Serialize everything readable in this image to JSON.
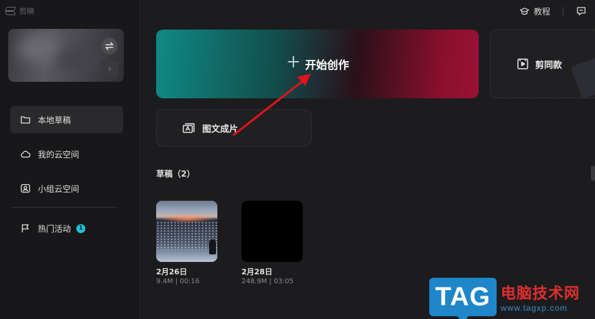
{
  "app": {
    "name": "剪映"
  },
  "topbar": {
    "tutorial_label": "教程"
  },
  "sidebar": {
    "items": [
      {
        "label": "本地草稿",
        "icon": "folder-icon",
        "active": true
      },
      {
        "label": "我的云空间",
        "icon": "cloud-icon",
        "active": false
      },
      {
        "label": "小组云空间",
        "icon": "team-cloud-icon",
        "active": false
      }
    ],
    "events": {
      "label": "热门活动",
      "badge": "1",
      "icon": "flag-icon"
    }
  },
  "main": {
    "start_label": "开始创作",
    "template_label": "剪同款",
    "imgtext_label": "图文成片",
    "drafts_title": "草稿（2）",
    "drafts": [
      {
        "name": "2月26日",
        "meta": "9.4M | 00:16"
      },
      {
        "name": "2月28日",
        "meta": "248.9M | 03:05"
      }
    ]
  },
  "watermark": {
    "tag": "TAG",
    "cn": "电脑技术网",
    "url": "www.tagxp.com"
  },
  "colors": {
    "accent_teal": "#0f8a85",
    "accent_red": "#9a1235",
    "badge": "#22c3d6",
    "arrow": "#e0141c"
  }
}
